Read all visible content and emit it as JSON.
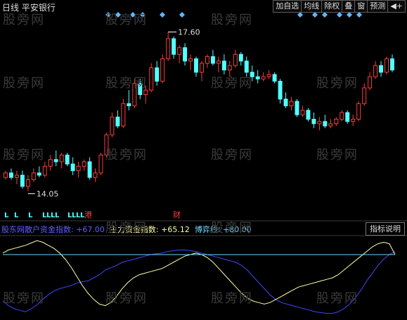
{
  "header": {
    "title": "日线 平安银行"
  },
  "toolbar": [
    {
      "label": "加自选",
      "icon": "",
      "name": "add-watchlist-button"
    },
    {
      "label": "均线",
      "icon": "",
      "name": "moving-average-button"
    },
    {
      "label": "除权",
      "icon": "",
      "name": "ex-rights-button"
    },
    {
      "label": "叠",
      "icon": "",
      "name": "overlay-button"
    },
    {
      "label": "窗",
      "icon": "",
      "name": "window-button"
    },
    {
      "label": "预测",
      "icon": "",
      "name": "forecast-button"
    },
    {
      "label": "",
      "icon": "◀+",
      "name": "nav-back-icon"
    }
  ],
  "price_marks": {
    "high": "17.60",
    "low": "14.05"
  },
  "event_labels": [
    "港",
    "财"
  ],
  "indicator": {
    "name": "股东网散户资金指数:",
    "retail_label": "散户资金指数:",
    "retail_value": "+67.00",
    "main_label": "主力资金指数:",
    "main_value": "+65.12",
    "game_label": "博弈线:",
    "game_value": "+80.00",
    "help_button": "指标说明"
  },
  "watermark": "股旁网",
  "colors": {
    "up": "#ff3c3c",
    "down": "#54ffff",
    "retail": "#3f48ff",
    "main": "#ffffa0",
    "game": "#6fd6ff",
    "diamond": "#5fb8ff",
    "marker": "#ffffff"
  },
  "chart_data": {
    "type": "candlestick",
    "ohlc": [
      [
        14.35,
        14.5,
        14.3,
        14.45
      ],
      [
        14.45,
        14.55,
        14.3,
        14.35
      ],
      [
        14.35,
        14.5,
        14.2,
        14.4
      ],
      [
        14.4,
        14.5,
        14.1,
        14.15
      ],
      [
        14.15,
        14.4,
        14.05,
        14.3
      ],
      [
        14.3,
        14.55,
        14.25,
        14.45
      ],
      [
        14.45,
        14.6,
        14.35,
        14.4
      ],
      [
        14.4,
        14.7,
        14.35,
        14.6
      ],
      [
        14.6,
        14.85,
        14.5,
        14.75
      ],
      [
        14.75,
        14.95,
        14.6,
        14.7
      ],
      [
        14.7,
        14.9,
        14.55,
        14.85
      ],
      [
        14.85,
        14.9,
        14.6,
        14.65
      ],
      [
        14.65,
        14.8,
        14.4,
        14.5
      ],
      [
        14.5,
        14.7,
        14.35,
        14.6
      ],
      [
        14.6,
        14.75,
        14.5,
        14.7
      ],
      [
        14.7,
        14.8,
        14.3,
        14.35
      ],
      [
        14.35,
        14.55,
        14.25,
        14.45
      ],
      [
        14.45,
        14.9,
        14.4,
        14.85
      ],
      [
        14.85,
        15.35,
        14.8,
        15.3
      ],
      [
        15.3,
        15.8,
        15.25,
        15.7
      ],
      [
        15.7,
        15.85,
        15.45,
        15.5
      ],
      [
        15.5,
        16.1,
        15.45,
        16.0
      ],
      [
        16.0,
        16.3,
        15.85,
        15.95
      ],
      [
        15.95,
        16.55,
        15.9,
        16.45
      ],
      [
        16.45,
        16.55,
        16.1,
        16.2
      ],
      [
        16.2,
        16.4,
        16.0,
        16.3
      ],
      [
        16.3,
        16.9,
        16.25,
        16.8
      ],
      [
        16.8,
        16.95,
        16.4,
        16.5
      ],
      [
        16.5,
        17.1,
        16.45,
        17.0
      ],
      [
        17.0,
        17.6,
        16.95,
        17.45
      ],
      [
        17.45,
        17.5,
        17.0,
        17.1
      ],
      [
        17.1,
        17.3,
        16.9,
        17.25
      ],
      [
        17.25,
        17.35,
        16.85,
        16.95
      ],
      [
        16.95,
        17.1,
        16.75,
        17.0
      ],
      [
        17.0,
        17.05,
        16.6,
        16.7
      ],
      [
        16.7,
        16.95,
        16.5,
        16.9
      ],
      [
        16.9,
        17.1,
        16.8,
        17.05
      ],
      [
        17.05,
        17.2,
        16.85,
        16.9
      ],
      [
        16.9,
        17.05,
        16.7,
        16.95
      ],
      [
        16.95,
        17.1,
        16.65,
        16.75
      ],
      [
        16.75,
        16.95,
        16.6,
        16.85
      ],
      [
        16.85,
        17.2,
        16.8,
        17.1
      ],
      [
        17.1,
        17.15,
        16.85,
        16.95
      ],
      [
        16.95,
        17.05,
        16.6,
        16.7
      ],
      [
        16.7,
        16.85,
        16.5,
        16.6
      ],
      [
        16.6,
        16.75,
        16.45,
        16.55
      ],
      [
        16.55,
        16.7,
        16.5,
        16.6
      ],
      [
        16.6,
        16.75,
        16.55,
        16.65
      ],
      [
        16.65,
        16.7,
        16.45,
        16.5
      ],
      [
        16.5,
        16.55,
        16.0,
        16.1
      ],
      [
        16.1,
        16.25,
        15.9,
        15.95
      ],
      [
        15.95,
        16.15,
        15.85,
        16.05
      ],
      [
        16.05,
        16.1,
        15.7,
        15.75
      ],
      [
        15.75,
        15.95,
        15.7,
        15.85
      ],
      [
        15.85,
        15.9,
        15.6,
        15.65
      ],
      [
        15.65,
        15.8,
        15.45,
        15.55
      ],
      [
        15.55,
        15.7,
        15.4,
        15.6
      ],
      [
        15.6,
        15.75,
        15.45,
        15.5
      ],
      [
        15.5,
        15.65,
        15.45,
        15.55
      ],
      [
        15.55,
        15.7,
        15.5,
        15.65
      ],
      [
        15.65,
        15.85,
        15.6,
        15.8
      ],
      [
        15.8,
        15.85,
        15.55,
        15.6
      ],
      [
        15.6,
        15.75,
        15.5,
        15.65
      ],
      [
        15.65,
        16.05,
        15.6,
        16.0
      ],
      [
        16.0,
        16.45,
        15.95,
        16.35
      ],
      [
        16.35,
        16.7,
        16.3,
        16.6
      ],
      [
        16.6,
        16.95,
        16.55,
        16.85
      ],
      [
        16.85,
        16.95,
        16.6,
        16.7
      ],
      [
        16.7,
        17.05,
        16.65,
        17.0
      ],
      [
        17.0,
        17.1,
        16.7,
        16.75
      ]
    ],
    "ylim": [
      13.6,
      18.0
    ],
    "annotations": [
      {
        "text": "17.60",
        "bar": 29,
        "price": 17.6
      },
      {
        "text": "14.05",
        "bar": 4,
        "price": 14.05
      }
    ],
    "indicator_series": [
      {
        "name": "散户资金指数",
        "color": "#3f48ff",
        "values": [
          20,
          14,
          10,
          8,
          6,
          10,
          15,
          22,
          28,
          33,
          36,
          38,
          40,
          43,
          45,
          46,
          50,
          54,
          60,
          63,
          66,
          70,
          72,
          74,
          76,
          78,
          80,
          81,
          82,
          84,
          85,
          86,
          86,
          85,
          84,
          82,
          80,
          78,
          76,
          74,
          72,
          70,
          66,
          60,
          52,
          44,
          36,
          28,
          22,
          18,
          16,
          14,
          12,
          10,
          8,
          6,
          5,
          4,
          4,
          6,
          10,
          16,
          24,
          34,
          46,
          56,
          66,
          74,
          80,
          84
        ]
      },
      {
        "name": "主力资金指数",
        "color": "#ffffa0",
        "values": [
          82,
          86,
          88,
          90,
          92,
          95,
          98,
          96,
          92,
          88,
          82,
          74,
          64,
          52,
          40,
          30,
          22,
          16,
          14,
          18,
          26,
          36,
          44,
          50,
          54,
          56,
          58,
          60,
          62,
          66,
          70,
          74,
          78,
          80,
          82,
          80,
          76,
          70,
          62,
          54,
          46,
          38,
          30,
          24,
          20,
          18,
          16,
          18,
          22,
          26,
          30,
          34,
          38,
          40,
          42,
          44,
          46,
          48,
          50,
          54,
          60,
          66,
          72,
          78,
          84,
          90,
          94,
          96,
          94,
          80
        ]
      },
      {
        "name": "博弈线",
        "color": "#6fd6ff",
        "values": [
          80,
          80,
          80,
          80,
          80,
          80,
          80,
          80,
          80,
          80,
          80,
          80,
          80,
          80,
          80,
          80,
          80,
          80,
          80,
          80,
          80,
          80,
          80,
          80,
          80,
          80,
          80,
          80,
          80,
          80,
          80,
          80,
          80,
          80,
          80,
          80,
          80,
          80,
          80,
          80,
          80,
          80,
          80,
          80,
          80,
          80,
          80,
          80,
          80,
          80,
          80,
          80,
          80,
          80,
          80,
          80,
          80,
          80,
          80,
          80,
          80,
          80,
          80,
          80,
          80,
          80,
          80,
          80,
          80,
          80
        ]
      }
    ]
  }
}
